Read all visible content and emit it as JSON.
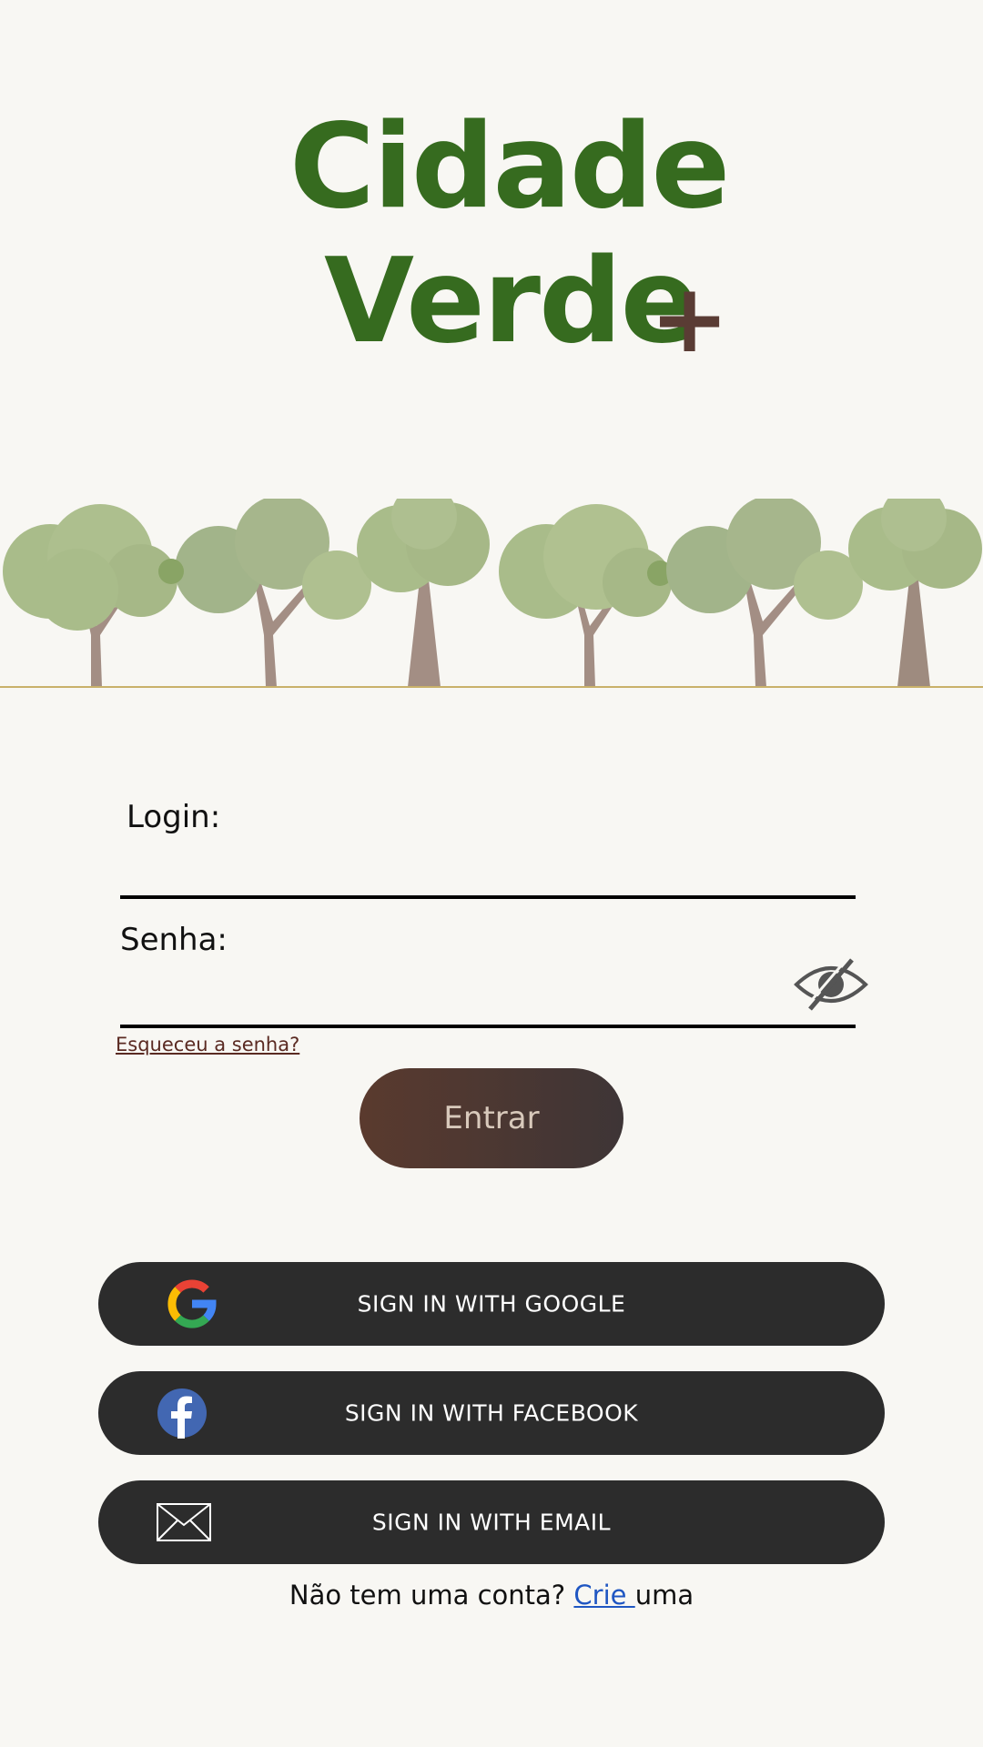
{
  "logo": {
    "line1": "Cidade",
    "line2": "Verde",
    "plus": "+"
  },
  "colors": {
    "brand_green": "#366b1f",
    "accent_brown": "#5a3c34",
    "background": "#f8f7f3",
    "ground": "#c9b16a"
  },
  "form": {
    "login_label": "Login:",
    "login_value": "",
    "password_label": "Senha:",
    "password_value": "",
    "toggle_icon": "eye-slash-icon",
    "forgot_link": "Esqueceu a senha?",
    "submit_label": "Entrar"
  },
  "social": {
    "google": {
      "label": "SIGN IN WITH GOOGLE",
      "icon": "google-icon"
    },
    "facebook": {
      "label": "SIGN IN WITH FACEBOOK",
      "icon": "facebook-icon"
    },
    "email": {
      "label": "SIGN IN WITH EMAIL",
      "icon": "envelope-icon"
    }
  },
  "signup": {
    "prompt": "Não tem uma conta? ",
    "link": "Crie ",
    "suffix": "uma"
  }
}
